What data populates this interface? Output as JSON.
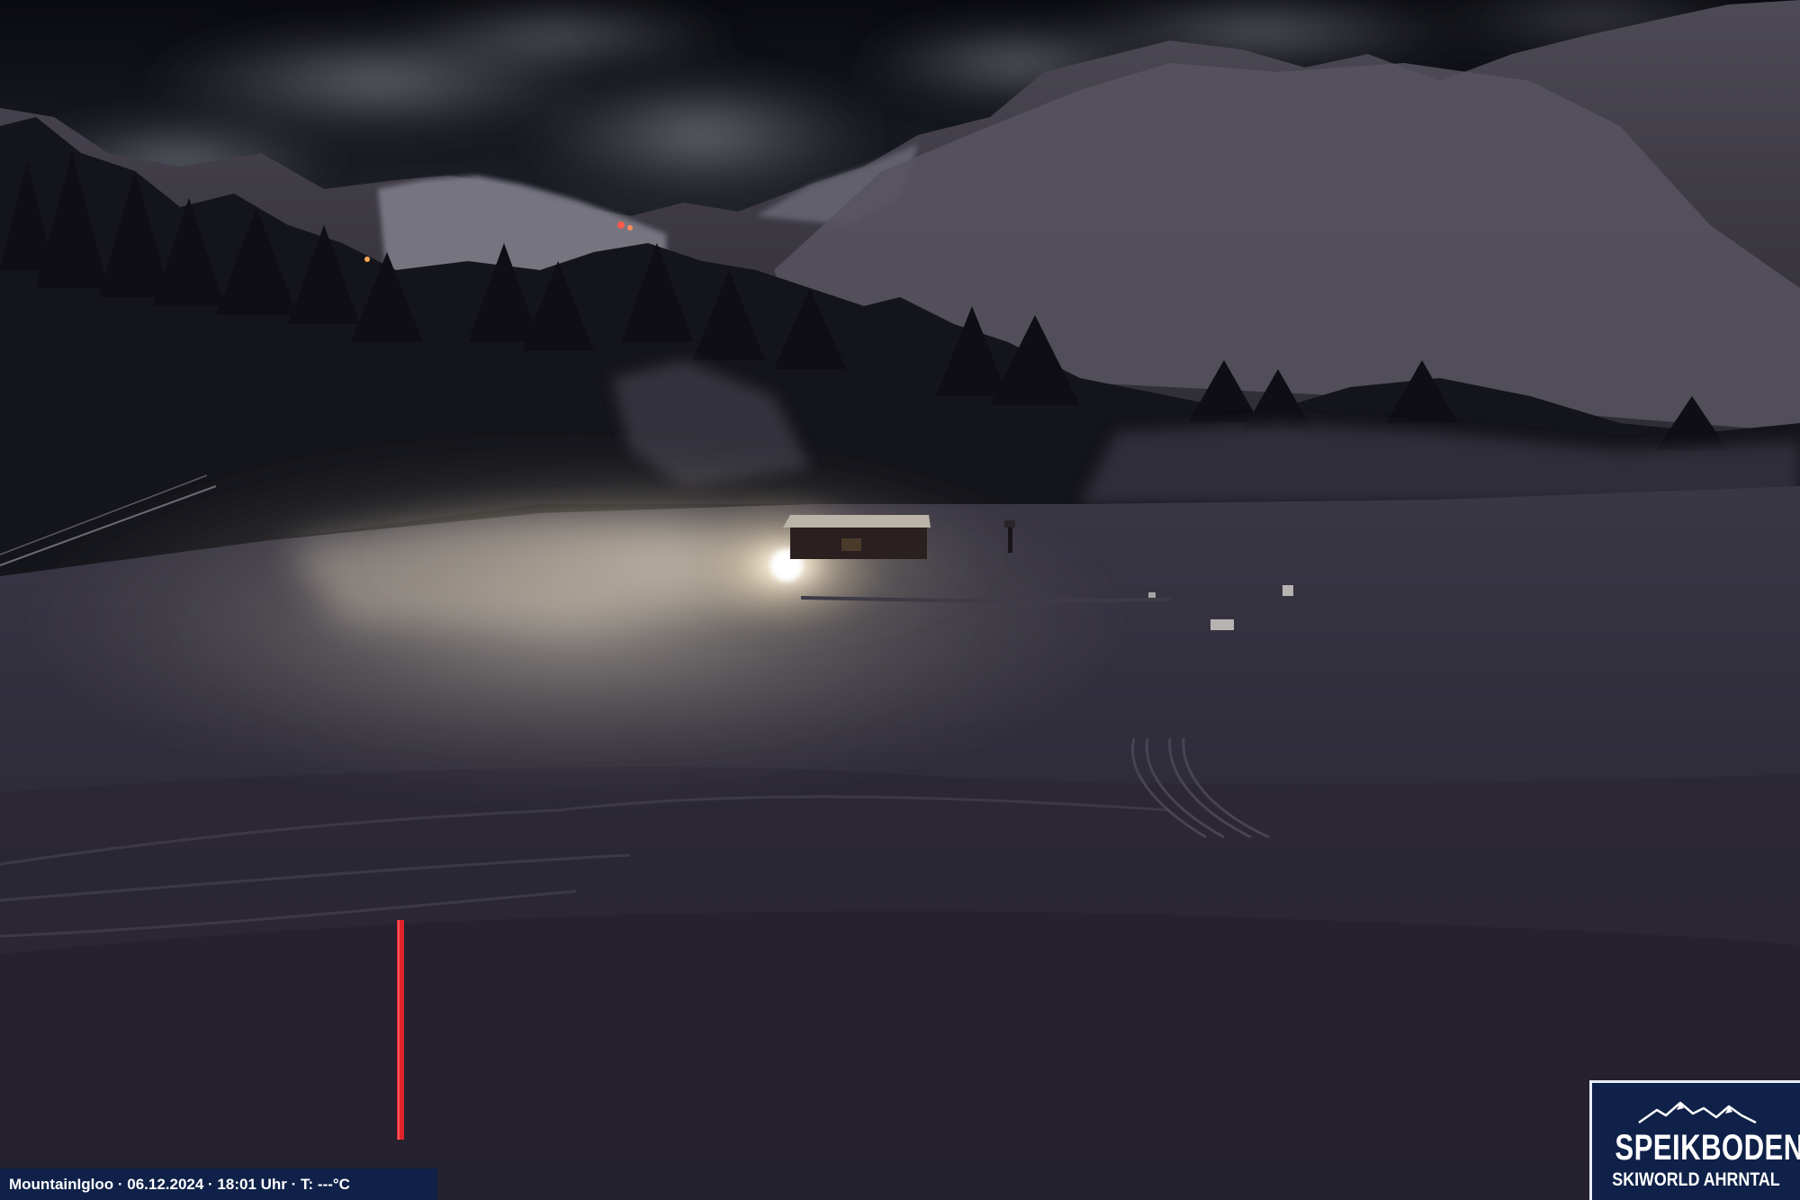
{
  "caption": {
    "text": "MountainIgloo · 06.12.2024 · 18:01 Uhr · T: ---°C"
  },
  "logo": {
    "title": "SPEIKBODEN",
    "subtitle": "SKIWORLD AHRNTAL"
  },
  "icons": {
    "logo_mark": "mountain-ridge-icon"
  },
  "colors": {
    "overlay": "#0f2148",
    "text": "#ffffff",
    "marker_pole": "#e0232a"
  }
}
